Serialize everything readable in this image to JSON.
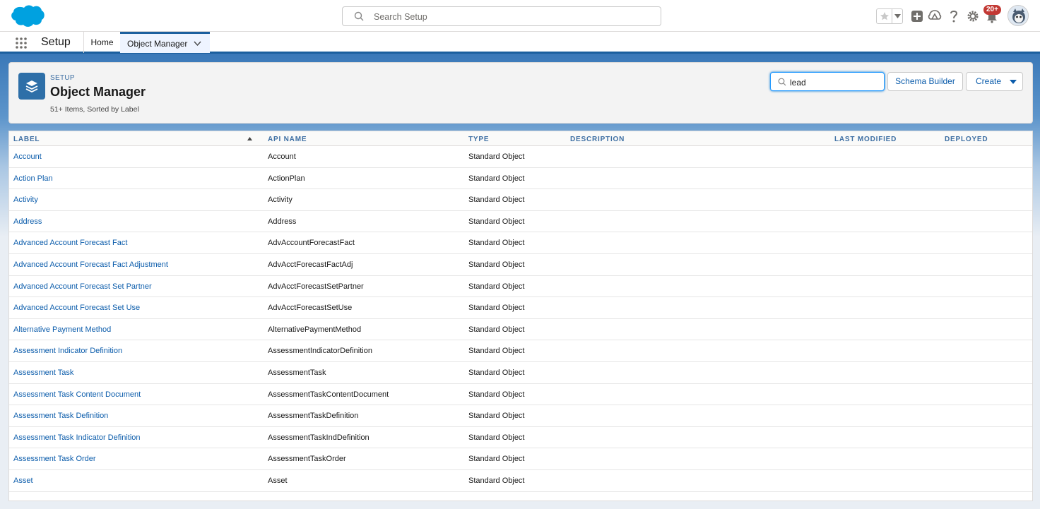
{
  "header": {
    "search_placeholder": "Search Setup",
    "notification_badge": "20+",
    "icons": [
      "favorites-star-icon",
      "favorites-dropdown-icon",
      "global-actions-add-icon",
      "trailhead-icon",
      "help-icon",
      "setup-gear-icon",
      "notifications-bell-icon",
      "user-avatar"
    ]
  },
  "context_bar": {
    "app_name": "Setup",
    "tabs": [
      {
        "label": "Home"
      },
      {
        "label": "Object Manager"
      }
    ]
  },
  "page_header": {
    "breadcrumb": "SETUP",
    "title": "Object Manager",
    "meta": "51+ Items, Sorted by Label",
    "quick_find_value": "lead",
    "schema_builder_label": "Schema Builder",
    "create_label": "Create"
  },
  "table": {
    "columns": [
      "LABEL",
      "API NAME",
      "TYPE",
      "DESCRIPTION",
      "LAST MODIFIED",
      "DEPLOYED"
    ],
    "rows": [
      {
        "label": "Account",
        "api": "Account",
        "type": "Standard Object"
      },
      {
        "label": "Action Plan",
        "api": "ActionPlan",
        "type": "Standard Object"
      },
      {
        "label": "Activity",
        "api": "Activity",
        "type": "Standard Object"
      },
      {
        "label": "Address",
        "api": "Address",
        "type": "Standard Object"
      },
      {
        "label": "Advanced Account Forecast Fact",
        "api": "AdvAccountForecastFact",
        "type": "Standard Object"
      },
      {
        "label": "Advanced Account Forecast Fact Adjustment",
        "api": "AdvAcctForecastFactAdj",
        "type": "Standard Object"
      },
      {
        "label": "Advanced Account Forecast Set Partner",
        "api": "AdvAcctForecastSetPartner",
        "type": "Standard Object"
      },
      {
        "label": "Advanced Account Forecast Set Use",
        "api": "AdvAcctForecastSetUse",
        "type": "Standard Object"
      },
      {
        "label": "Alternative Payment Method",
        "api": "AlternativePaymentMethod",
        "type": "Standard Object"
      },
      {
        "label": "Assessment Indicator Definition",
        "api": "AssessmentIndicatorDefinition",
        "type": "Standard Object"
      },
      {
        "label": "Assessment Task",
        "api": "AssessmentTask",
        "type": "Standard Object"
      },
      {
        "label": "Assessment Task Content Document",
        "api": "AssessmentTaskContentDocument",
        "type": "Standard Object"
      },
      {
        "label": "Assessment Task Definition",
        "api": "AssessmentTaskDefinition",
        "type": "Standard Object"
      },
      {
        "label": "Assessment Task Indicator Definition",
        "api": "AssessmentTaskIndDefinition",
        "type": "Standard Object"
      },
      {
        "label": "Assessment Task Order",
        "api": "AssessmentTaskOrder",
        "type": "Standard Object"
      },
      {
        "label": "Asset",
        "api": "Asset",
        "type": "Standard Object"
      }
    ]
  },
  "colors": {
    "brand_blue": "#1b5f9e",
    "link_blue": "#0b5cab",
    "badge_red": "#c23934",
    "object_icon_blue": "#2e6fa8"
  }
}
